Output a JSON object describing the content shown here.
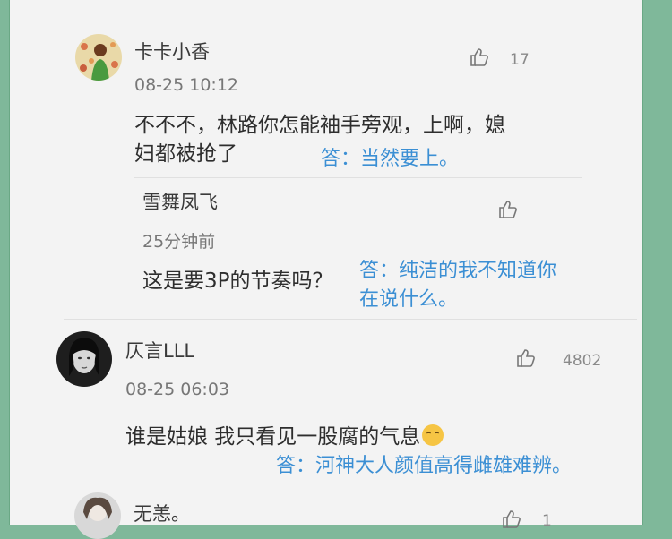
{
  "comments": [
    {
      "name": "卡卡小香",
      "time": "08-25 10:12",
      "likes": "17",
      "text_line1": "不不不，林路你怎能袖手旁观，上啊，媳",
      "text_line2": "妇都被抢了",
      "note": "答：当然要上。"
    },
    {
      "name": "雪舞凤飞",
      "time": "25分钟前",
      "likes": "",
      "text": "这是要3P的节奏吗？",
      "note_line1": "答：纯洁的我不知道你",
      "note_line2": "在说什么。"
    },
    {
      "name": "仄言LLL",
      "time": "08-25 06:03",
      "likes": "4802",
      "text": "谁是姑娘 我只看见一股腐的气息",
      "emoji": "laughing-crying-emoji",
      "note": "答：河神大人颜值高得雌雄难辨。"
    },
    {
      "name": "无恙。",
      "likes": "1"
    }
  ]
}
